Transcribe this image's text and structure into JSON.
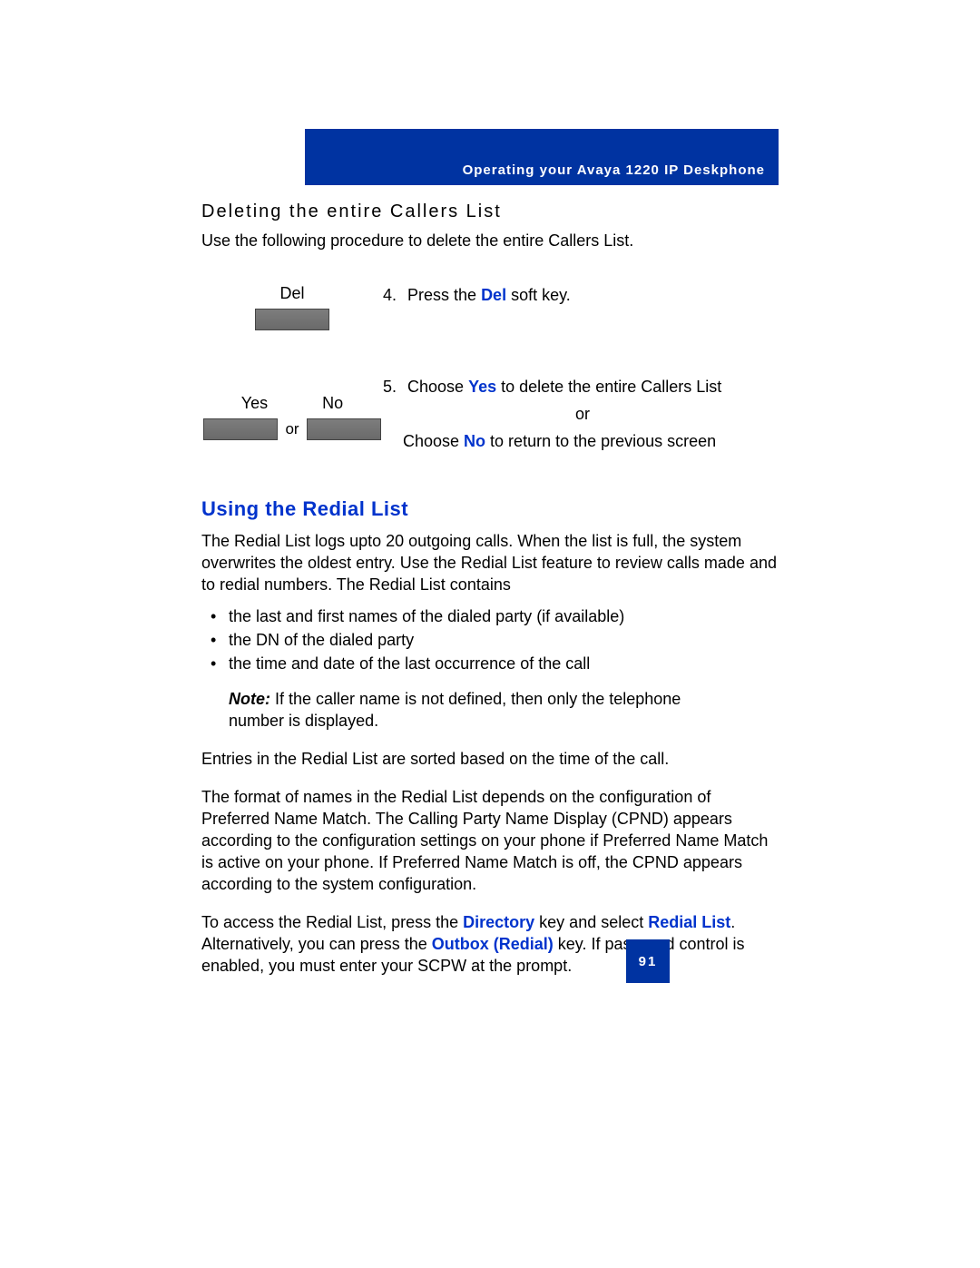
{
  "header": "Operating your Avaya 1220 IP Deskphone",
  "sub1": {
    "title": "Deleting the entire Callers List",
    "intro": "Use the following procedure to delete the entire Callers List."
  },
  "step4": {
    "label": "Del",
    "num": "4.",
    "pre": "Press the ",
    "kw": "Del",
    "post": " soft key."
  },
  "step5": {
    "labelYes": "Yes",
    "labelNo": "No",
    "orSmall": "or",
    "num": "5.",
    "line1_pre": "Choose ",
    "line1_kw": "Yes",
    "line1_post": " to delete the entire Callers List",
    "orCenter": "or",
    "line2_pre": "Choose ",
    "line2_kw": "No",
    "line2_post": " to return to the previous screen"
  },
  "section2": {
    "title": "Using the Redial List",
    "p1": "The Redial List logs upto 20 outgoing calls. When the list is full, the system overwrites the oldest entry. Use the Redial List feature to review calls made and to redial numbers. The Redial List contains",
    "bullets": [
      "the last and first names of the dialed party (if available)",
      "the DN of the dialed party",
      "the time and date of the last occurrence of the call"
    ],
    "noteLabel": "Note:",
    "noteText": " If the caller name is not defined, then only the telephone number is displayed.",
    "p2": "Entries in the Redial List are sorted based on the time of the call.",
    "p3": "The format of names in the Redial List depends on the configuration of Preferred Name Match. The Calling Party Name Display (CPND) appears according to the configuration settings on your phone if Preferred Name Match is active on your phone. If Preferred Name Match is off, the CPND appears according to the system configuration.",
    "p4_a": "To access the Redial List, press the ",
    "p4_kw1": "Directory",
    "p4_b": " key and select ",
    "p4_kw2": "Redial List",
    "p4_c": ". Alternatively, you can press the ",
    "p4_kw3": "Outbox (Redial)",
    "p4_d": " key. If password control is enabled, you must enter your SCPW at the prompt."
  },
  "pageNumber": "91"
}
